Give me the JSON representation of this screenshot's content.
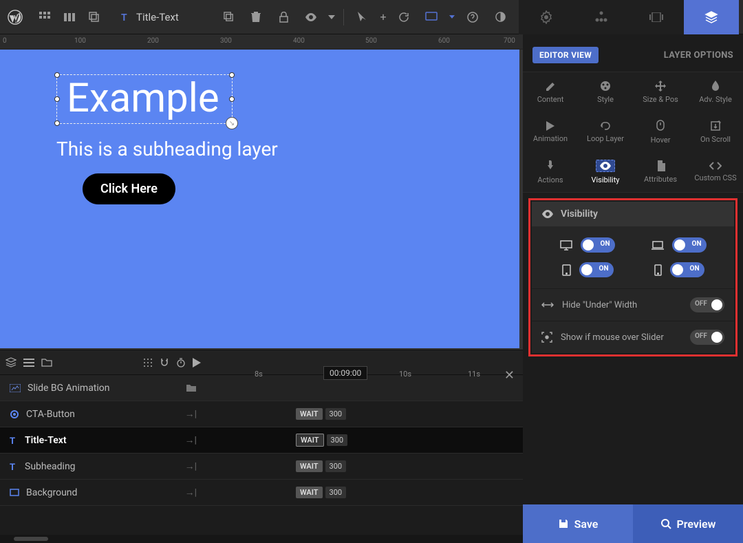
{
  "toolbar": {
    "selected_layer": "Title-Text"
  },
  "ruler": {
    "ticks": [
      "0",
      "100",
      "200",
      "300",
      "400",
      "500",
      "600",
      "700"
    ]
  },
  "canvas": {
    "title": "Example",
    "subheading": "This is a subheading layer",
    "cta": "Click Here"
  },
  "timeline": {
    "marks": [
      "8s",
      "10s",
      "11s"
    ],
    "current": "00:09:00",
    "group": "Slide BG Animation",
    "rows": [
      {
        "name": "CTA-Button",
        "wait": "WAIT",
        "val": "300"
      },
      {
        "name": "Title-Text",
        "wait": "WAIT",
        "val": "300"
      },
      {
        "name": "Subheading",
        "wait": "WAIT",
        "val": "300"
      },
      {
        "name": "Background",
        "wait": "WAIT",
        "val": "300"
      }
    ]
  },
  "sidebar": {
    "editor_view": "EDITOR VIEW",
    "layer_options": "LAYER OPTIONS",
    "options": [
      "Content",
      "Style",
      "Size & Pos",
      "Adv. Style",
      "Animation",
      "Loop Layer",
      "Hover",
      "On Scroll",
      "Actions",
      "Visibility",
      "Attributes",
      "Custom CSS"
    ],
    "visibility": {
      "title": "Visibility",
      "on": "ON",
      "off": "OFF",
      "hide_under": "Hide \"Under\" Width",
      "show_mouse": "Show if mouse over Slider"
    },
    "save": "Save",
    "preview": "Preview"
  }
}
